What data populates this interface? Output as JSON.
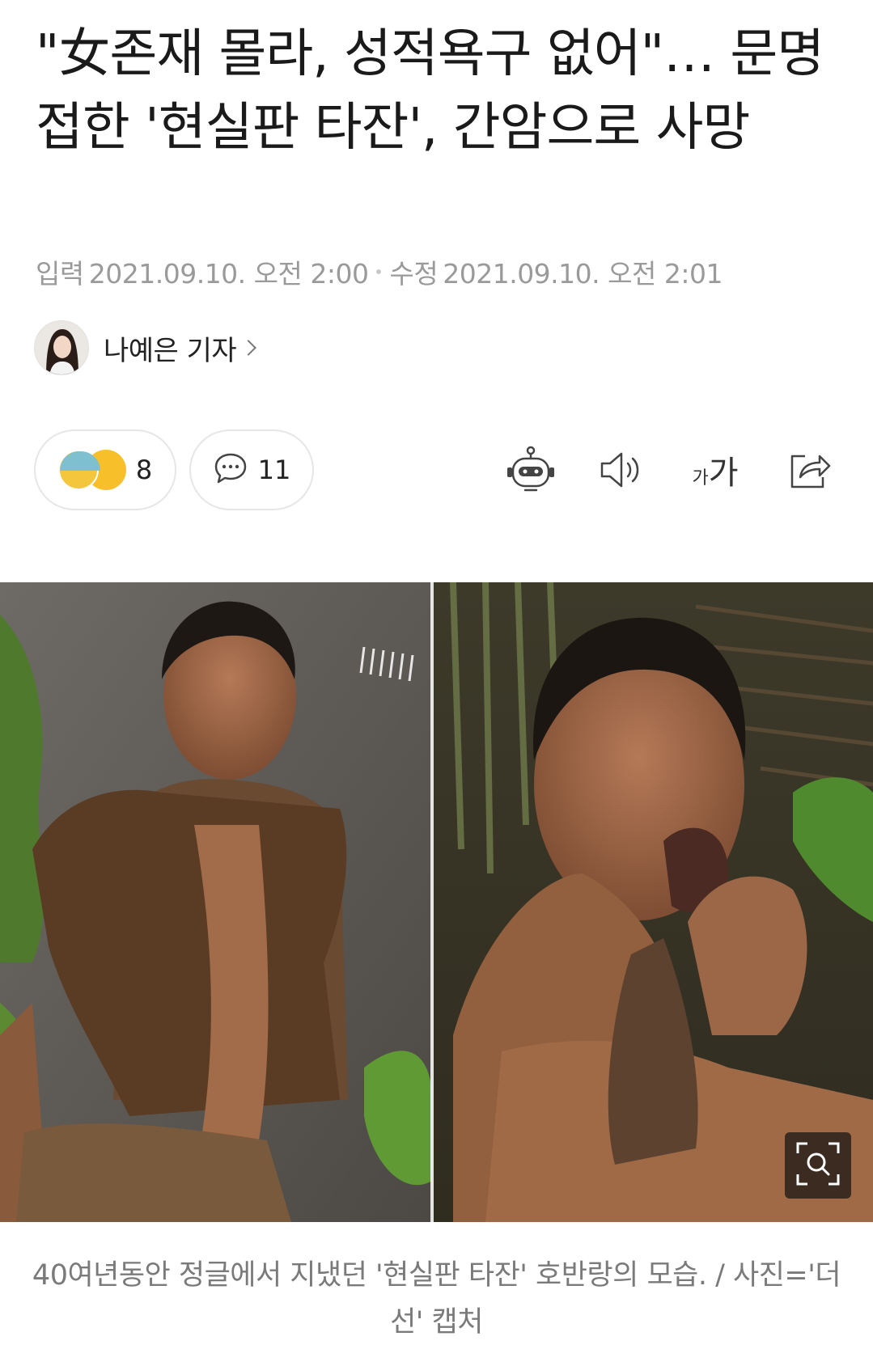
{
  "article": {
    "headline": "\"女존재 몰라, 성적욕구 없어\"… 문명 접한 '현실판 타잔', 간암으로 사망",
    "published_label": "입력",
    "published_time": "2021.09.10. 오전 2:00",
    "modified_label": "수정",
    "modified_time": "2021.09.10. 오전 2:01"
  },
  "author": {
    "name": "나예은 기자"
  },
  "reactions": {
    "count": "8",
    "comment_count": "11"
  },
  "icons": {
    "reaction_sad": "sad-emoji-icon",
    "reaction_happy": "happy-emoji-icon",
    "comment": "speech-bubble-icon",
    "summary_bot": "robot-icon",
    "listen": "speaker-icon",
    "font_size": "font-size-icon",
    "share": "share-icon",
    "zoom": "zoom-search-icon"
  },
  "font_size_glyph": {
    "small": "가",
    "large": "가"
  },
  "photo": {
    "caption": "40여년동안 정글에서 지냈던 '현실판 타잔' 호반랑의 모습. / 사진='더 선' 캡처"
  },
  "colors": {
    "text": "#1a1a1a",
    "meta": "#9a9a9a",
    "caption": "#7a7a7a",
    "pill_border": "#e6e6e6"
  }
}
